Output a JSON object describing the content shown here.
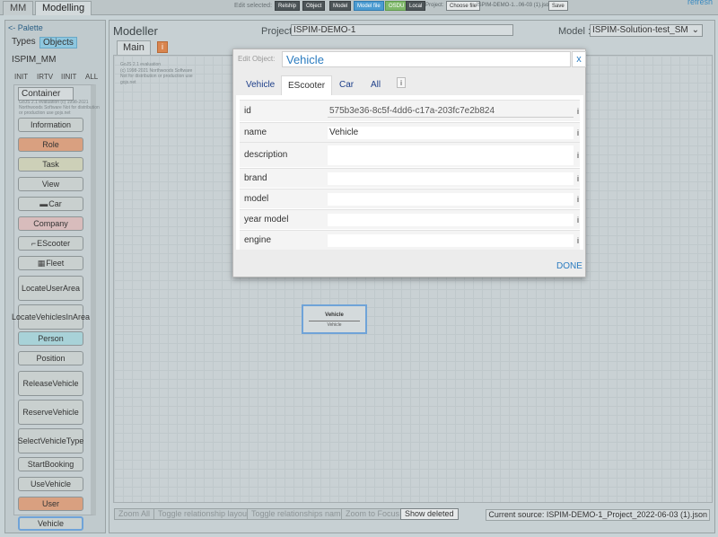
{
  "app": {
    "tabs": [
      {
        "label": "MM"
      },
      {
        "label": "Modelling"
      }
    ],
    "refresh": "refresh"
  },
  "toolbar": {
    "edit_selected": "Edit selected:",
    "buttons": [
      {
        "label": "Relship"
      },
      {
        "label": "Object"
      },
      {
        "label": "Model"
      },
      {
        "label": "Model file"
      },
      {
        "label": "OSDU"
      },
      {
        "label": "Local"
      }
    ],
    "project_label": "Project:",
    "choose_file": "Choose file",
    "file_name": "ISPIM-DEMO-1...06-03 (1).json",
    "save": "Save"
  },
  "palette": {
    "header": "<- Palette",
    "tabs": [
      {
        "label": "Types"
      },
      {
        "label": "Objects"
      }
    ],
    "metamodel": "ISPIM_MM",
    "filters": [
      {
        "label": "INIT"
      },
      {
        "label": "IRTV"
      },
      {
        "label": "IINIT"
      },
      {
        "label": "ALL"
      }
    ],
    "container_label": "Container",
    "container_watermark": "GoJS 2.1 evaluation (c) 1998-2021 Northwoods Software Not for distribution or production use gojs.net",
    "items": [
      {
        "label": "Information",
        "color": "#c9d0cf",
        "icon": ""
      },
      {
        "label": "Role",
        "color": "#d9a080",
        "icon": ""
      },
      {
        "label": "Task",
        "color": "#cdd0b8",
        "icon": ""
      },
      {
        "label": "View",
        "color": "#c9d0cf",
        "icon": ""
      },
      {
        "label": "Car",
        "color": "#c9d0cf",
        "icon": "car-icon"
      },
      {
        "label": "Company",
        "color": "#d8bcbc",
        "icon": ""
      },
      {
        "label": "EScooter",
        "color": "#c9d0cf",
        "icon": "scooter-icon"
      },
      {
        "label": "Fleet",
        "color": "#c9d0cf",
        "icon": "fleet-icon"
      },
      {
        "label": "LocateUserArea",
        "color": "#c9d0cf",
        "icon": ""
      },
      {
        "label": "LocateVehiclesInArea",
        "color": "#c9d0cf",
        "icon": ""
      },
      {
        "label": "Person",
        "color": "#a8d2d8",
        "icon": ""
      },
      {
        "label": "Position",
        "color": "#c9d0cf",
        "icon": ""
      },
      {
        "label": "ReleaseVehicle",
        "color": "#c9d0cf",
        "icon": ""
      },
      {
        "label": "ReserveVehicle",
        "color": "#c9d0cf",
        "icon": ""
      },
      {
        "label": "SelectVehicleType",
        "color": "#c9d0cf",
        "icon": ""
      },
      {
        "label": "StartBooking",
        "color": "#c9d0cf",
        "icon": ""
      },
      {
        "label": "UseVehicle",
        "color": "#c9d0cf",
        "icon": ""
      },
      {
        "label": "User",
        "color": "#d9a080",
        "icon": ""
      },
      {
        "label": "Vehicle",
        "color": "#c9d0cf",
        "icon": ""
      }
    ]
  },
  "modeller": {
    "title": "Modeller",
    "project_label": "Project :",
    "project_value": "ISPIM-DEMO-1",
    "model_label": "Model :",
    "model_value": "ISPIM-Solution-test_SM",
    "main_tab": "Main",
    "orange_btn": "i",
    "eval_text": [
      "GoJS 2.1 evaluation",
      "(c) 1998-2021 Northwoods Software",
      "Not for distribution or production use",
      "gojs.net"
    ],
    "node": {
      "title": "Vehicle",
      "subtitle": "Vehicle"
    },
    "bottom_buttons": [
      {
        "label": "Zoom All",
        "enabled": false
      },
      {
        "label": "Toggle relationship layout",
        "enabled": false
      },
      {
        "label": "Toggle relationships name",
        "enabled": false
      },
      {
        "label": "Zoom to Focus",
        "enabled": false
      },
      {
        "label": "Show deleted",
        "enabled": true
      }
    ],
    "current_source": "Current source: ISPIM-DEMO-1_Project_2022-06-03 (1).json"
  },
  "modal": {
    "header_label": "Edit Object:",
    "title": "Vehicle",
    "close": "x",
    "tabs": [
      {
        "label": "Vehicle",
        "active": false
      },
      {
        "label": "EScooter",
        "active": true
      },
      {
        "label": "Car",
        "active": false
      },
      {
        "label": "All",
        "active": false
      }
    ],
    "tab_info": "i",
    "properties": [
      {
        "label": "id",
        "value": "575b3e36-8c5f-4dd6-c17a-203fc7e2b824",
        "readonly": true,
        "info": "i"
      },
      {
        "label": "name",
        "value": "Vehicle",
        "readonly": false,
        "info": "i"
      },
      {
        "label": "description",
        "value": "",
        "readonly": false,
        "info": "i",
        "multiline": true
      },
      {
        "label": "brand",
        "value": "",
        "readonly": false,
        "info": "i"
      },
      {
        "label": "model",
        "value": "",
        "readonly": false,
        "info": "i"
      },
      {
        "label": "year model",
        "value": "",
        "readonly": false,
        "info": "i"
      },
      {
        "label": "engine",
        "value": "",
        "readonly": false,
        "info": "i"
      }
    ],
    "done": "DONE"
  }
}
